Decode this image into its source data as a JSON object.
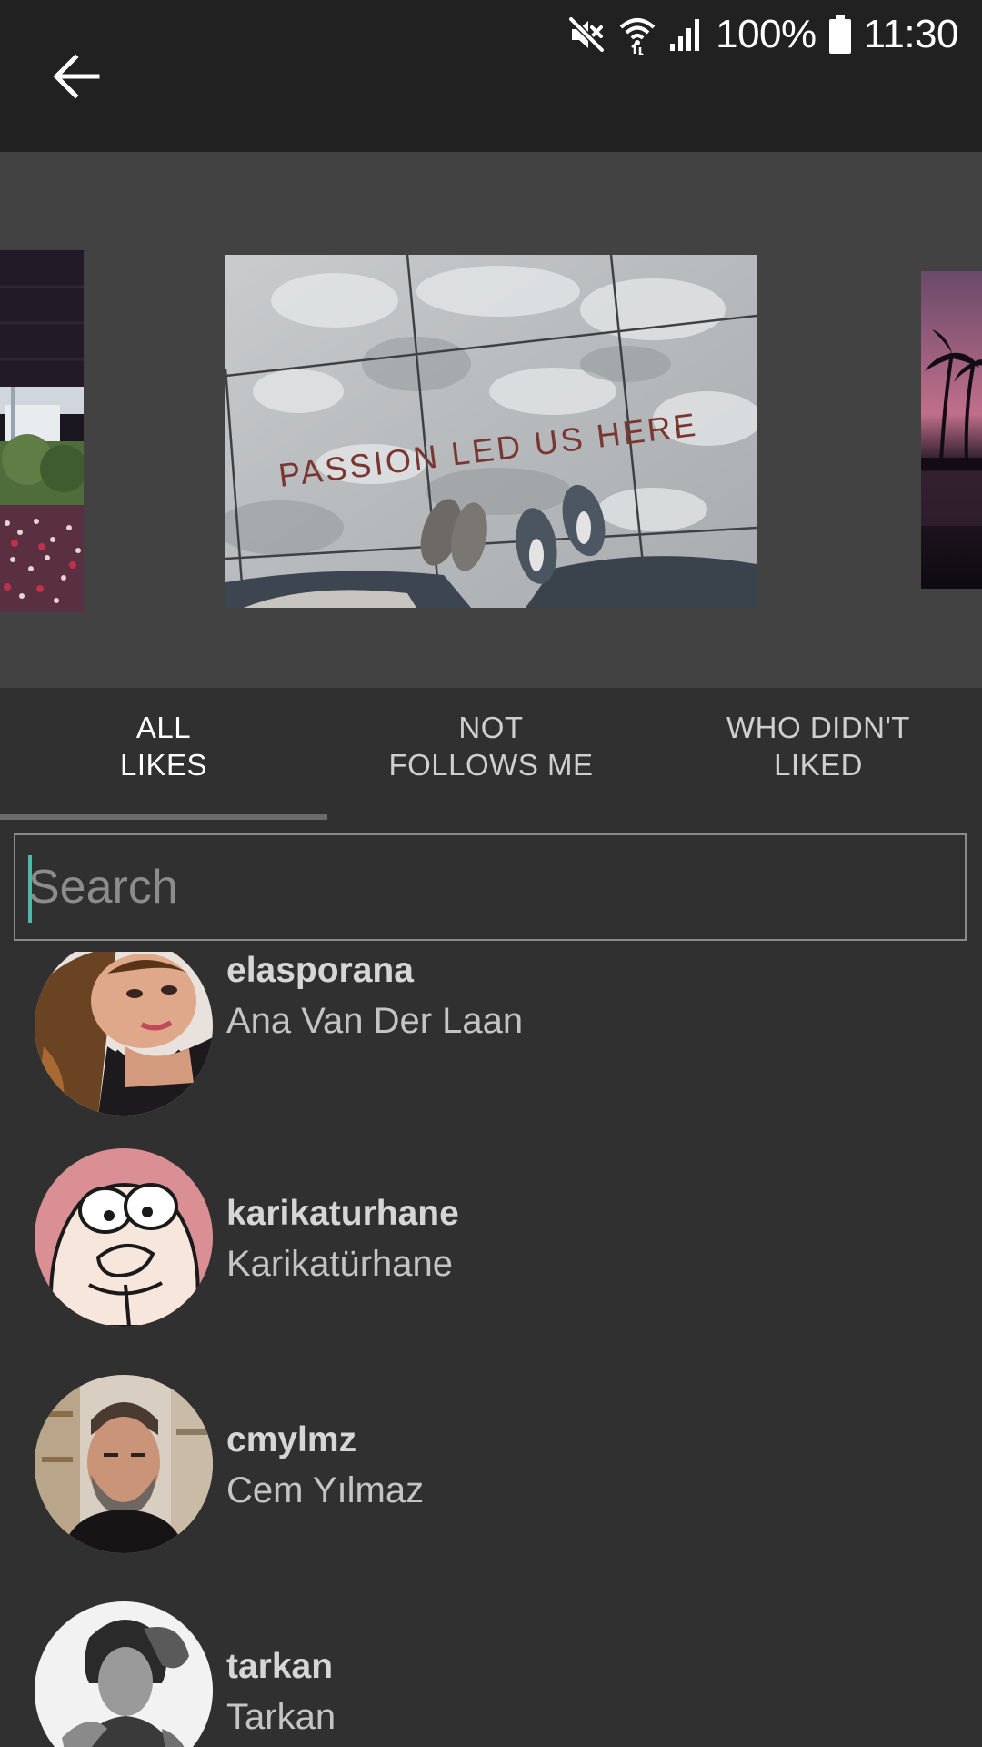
{
  "status_bar": {
    "battery": "100%",
    "time": "11:30",
    "icons": [
      "mute-icon",
      "wifi-icon",
      "signal-icon",
      "battery-icon"
    ]
  },
  "header": {
    "back_icon": "arrow-back-icon"
  },
  "carousel": {
    "center_photo_text": "PASSION LED US HERE"
  },
  "tabs": [
    {
      "label": "ALL\nLIKES",
      "active": true
    },
    {
      "label": "NOT\nFOLLOWS ME",
      "active": false
    },
    {
      "label": "WHO DIDN'T\nLIKED",
      "active": false
    }
  ],
  "search": {
    "placeholder": "Search",
    "value": ""
  },
  "users": [
    {
      "username": "elasporana",
      "name": "Ana Van Der Laan"
    },
    {
      "username": "karikaturhane",
      "name": "Karikatürhane"
    },
    {
      "username": "cmylmz",
      "name": "Cem Yılmaz"
    },
    {
      "username": "tarkan",
      "name": "Tarkan"
    }
  ],
  "colors": {
    "app_bar": "#212121",
    "background": "#303030",
    "carousel_bg": "#424242",
    "cursor": "#4fb8a8"
  }
}
